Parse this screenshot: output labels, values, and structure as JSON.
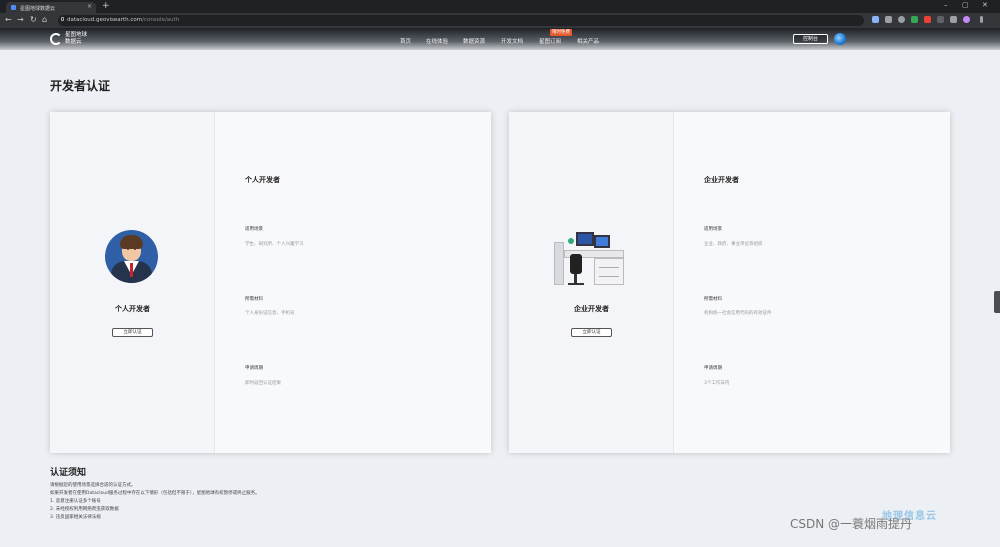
{
  "browser": {
    "tab_title": "星图地球数据云",
    "tab_close": "×",
    "new_tab": "+",
    "win_min": "–",
    "win_max": "▢",
    "win_close": "✕",
    "back": "←",
    "forward": "→",
    "reload": "↻",
    "home": "⌂",
    "url_host": "datacloud.geovisearth.com",
    "url_path": "/console/auth"
  },
  "header": {
    "logo_line1": "星图地球",
    "logo_line2": "数据云",
    "nav": [
      "首页",
      "在线体验",
      "数据资源",
      "开发文档",
      "星图订阅",
      "相关产品"
    ],
    "hot_badge": "限时免费",
    "console_button": "控制台"
  },
  "page_title": "开发者认证",
  "cards": [
    {
      "role_title": "个人开发者",
      "button": "立即认证",
      "heading": "个人开发者",
      "fields": [
        {
          "label": "适用场景",
          "value": "学生、研究所、个人兴趣学习"
        },
        {
          "label": "所需材料",
          "value": "个人身份证信息、手机号"
        },
        {
          "label": "申请周期",
          "value": "即时返回认证结果"
        }
      ]
    },
    {
      "role_title": "企业开发者",
      "button": "立即认证",
      "heading": "企业开发者",
      "fields": [
        {
          "label": "适用场景",
          "value": "企业、政府、事业单位等组织"
        },
        {
          "label": "所需材料",
          "value": "机构统一社会信用代码的有效证件"
        },
        {
          "label": "申请周期",
          "value": "3个工作日内"
        }
      ]
    }
  ],
  "notes": {
    "title": "认证须知",
    "lines": [
      "请根据您的使用场景选择合适的认证方式。",
      "如果开发者在使用Datacloud服务过程中存在以下情形（包括但不限于），星图地球有权暂停或终止服务。",
      "1. 恶意注册认证多个账号",
      "2. 未经授权利用网络爬虫获取数据",
      "3. 违反国家相关法律法规"
    ]
  },
  "watermark": {
    "text": "CSDN @一蓑烟雨提丹",
    "logo_text": "地理信息云"
  },
  "colors": {
    "hot_badge": "#e65a2f",
    "background": "#eceff3"
  }
}
